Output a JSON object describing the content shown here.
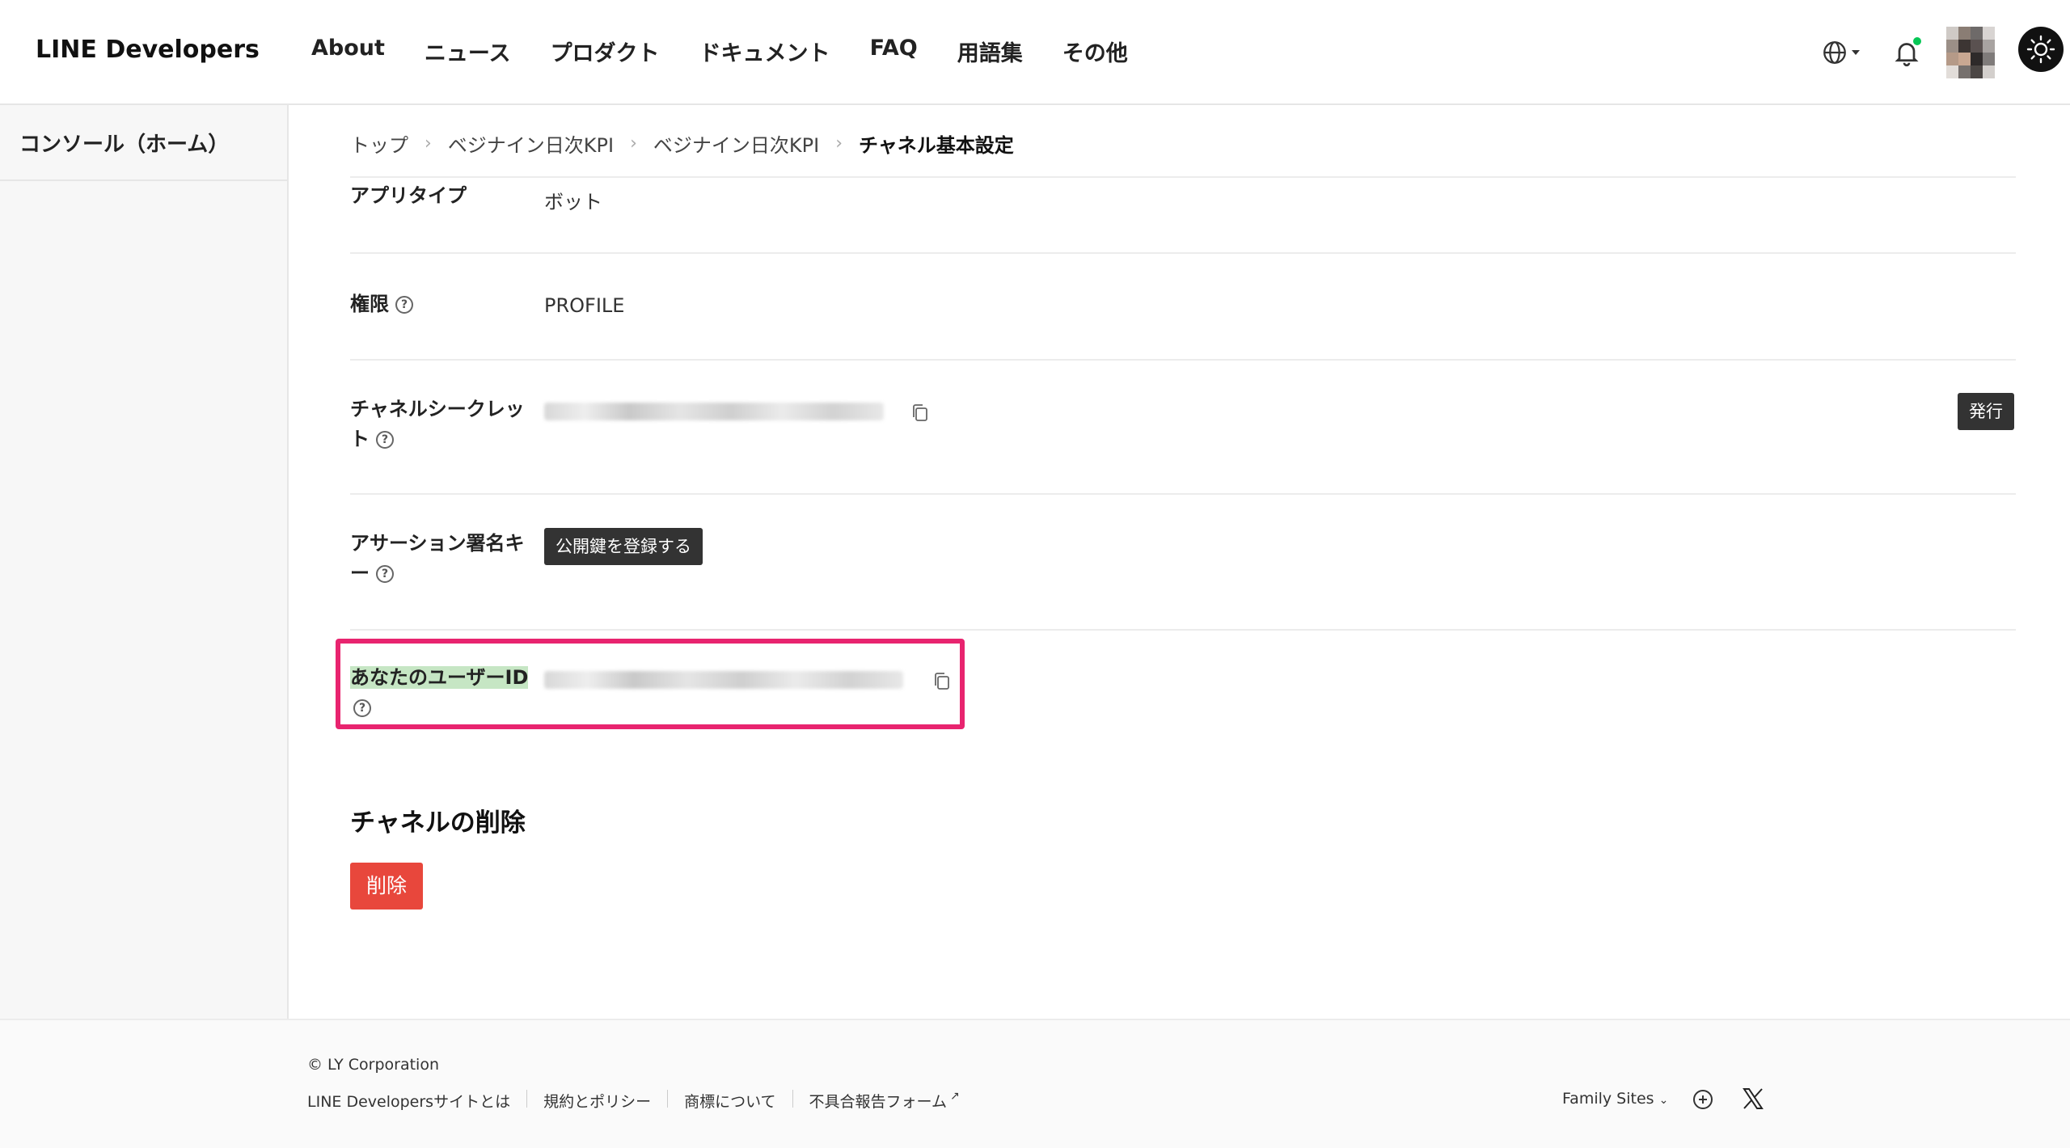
{
  "header": {
    "logo": "LINE Developers",
    "nav": [
      "About",
      "ニュース",
      "プロダクト",
      "ドキュメント",
      "FAQ",
      "用語集",
      "その他"
    ]
  },
  "sidebar": {
    "home_label": "コンソール（ホーム）"
  },
  "breadcrumb": {
    "items": [
      "トップ",
      "ベジナイン日次KPI",
      "ベジナイン日次KPI"
    ],
    "current": "チャネル基本設定",
    "separator": "›"
  },
  "settings": {
    "app_type": {
      "label": "アプリタイプ",
      "value": "ボット"
    },
    "permission": {
      "label": "権限",
      "value": "PROFILE"
    },
    "channel_secret": {
      "label_line1": "チャネルシークレッ",
      "label_line2": "ト",
      "issue_button": "発行"
    },
    "assertion_key": {
      "label_line1": "アサーション署名キ",
      "label_line2": "ー",
      "register_button": "公開鍵を登録する"
    },
    "user_id": {
      "label": "あなたのユーザーID"
    }
  },
  "delete_section": {
    "title": "チャネルの削除",
    "button": "削除"
  },
  "footer": {
    "copyright": "© LY Corporation",
    "links": [
      "LINE Developersサイトとは",
      "規約とポリシー",
      "商標について",
      "不具合報告フォーム"
    ],
    "family_sites": "Family Sites"
  },
  "colors": {
    "accent_highlight": "#e8246f",
    "delete_red": "#e8473c",
    "label_highlight": "#c6e6c4",
    "notification_green": "#06c755"
  }
}
